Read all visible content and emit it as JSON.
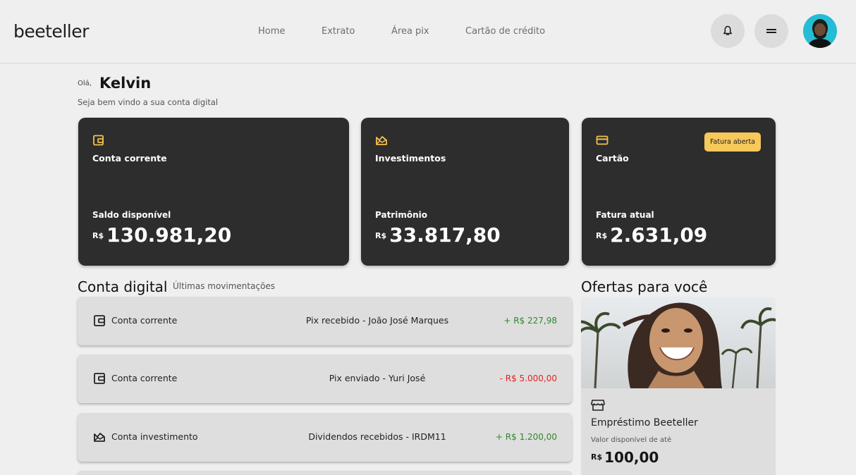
{
  "brand": {
    "logo": "beeteller"
  },
  "nav": {
    "items": [
      {
        "label": "Home"
      },
      {
        "label": "Extrato"
      },
      {
        "label": "Área pix"
      },
      {
        "label": "Cartão de crédito"
      }
    ]
  },
  "header_icons": {
    "notifications": "bell-icon",
    "menu": "menu-icon",
    "avatar": "avatar"
  },
  "greeting": {
    "hello": "Olá,",
    "name": "Kelvin",
    "subtitle": "Seja bem vindo a sua conta digital"
  },
  "cards": [
    {
      "icon": "wallet-icon",
      "title": "Conta corrente",
      "label": "Saldo disponível",
      "currency": "R$",
      "amount": "130.981,20"
    },
    {
      "icon": "chart-icon",
      "title": "Investimentos",
      "label": "Patrimônio",
      "currency": "R$",
      "amount": "33.817,80"
    },
    {
      "icon": "credit-card-icon",
      "title": "Cartão",
      "label": "Fatura atual",
      "currency": "R$",
      "amount": "2.631,09",
      "badge": "Fatura aberta"
    }
  ],
  "account": {
    "title": "Conta digital",
    "subtitle": "Últimas movimentações",
    "transactions": [
      {
        "icon": "wallet-icon",
        "account": "Conta corrente",
        "description": "Pix recebido - João José Marques",
        "value": "+ R$ 227,98",
        "type": "positive"
      },
      {
        "icon": "wallet-icon",
        "account": "Conta corrente",
        "description": "Pix enviado - Yuri José",
        "value": "- R$ 5.000,00",
        "type": "negative"
      },
      {
        "icon": "chart-icon",
        "account": "Conta investimento",
        "description": "Dividendos recebidos - IRDM11",
        "value": "+ R$ 1.200,00",
        "type": "positive"
      }
    ]
  },
  "offers": {
    "title": "Ofertas para você",
    "item": {
      "icon": "store-icon",
      "title": "Empréstimo Beeteller",
      "subtitle": "Valor disponível de até",
      "currency": "R$",
      "amount": "100,00"
    }
  },
  "colors": {
    "accent": "#f7c85a",
    "card_bg": "#2d2d2d",
    "positive": "#2d8a2d",
    "negative": "#e02424",
    "avatar_bg": "#26bcd4"
  }
}
